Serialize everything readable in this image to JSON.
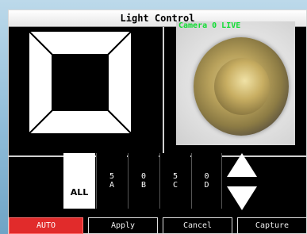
{
  "window": {
    "title": "Light Control"
  },
  "frame": {
    "segments": [
      {
        "id": "A",
        "label": "A"
      },
      {
        "id": "B",
        "label": "B"
      },
      {
        "id": "C",
        "label": "C"
      },
      {
        "id": "D",
        "label": "D"
      }
    ]
  },
  "camera": {
    "label": "Camera 0 LIVE"
  },
  "selectors": {
    "all": "ALL",
    "channels": [
      {
        "value": "5",
        "segment": "A"
      },
      {
        "value": "0",
        "segment": "B"
      },
      {
        "value": "5",
        "segment": "C"
      },
      {
        "value": "0",
        "segment": "D"
      }
    ]
  },
  "arrows": {
    "up_icon": "triangle-up",
    "down_icon": "triangle-down"
  },
  "buttons": {
    "auto": "AUTO",
    "apply": "Apply",
    "cancel": "Cancel",
    "capture": "Capture"
  },
  "colors": {
    "auto_active": "#e12b2b",
    "camera_text": "#11dd33"
  }
}
